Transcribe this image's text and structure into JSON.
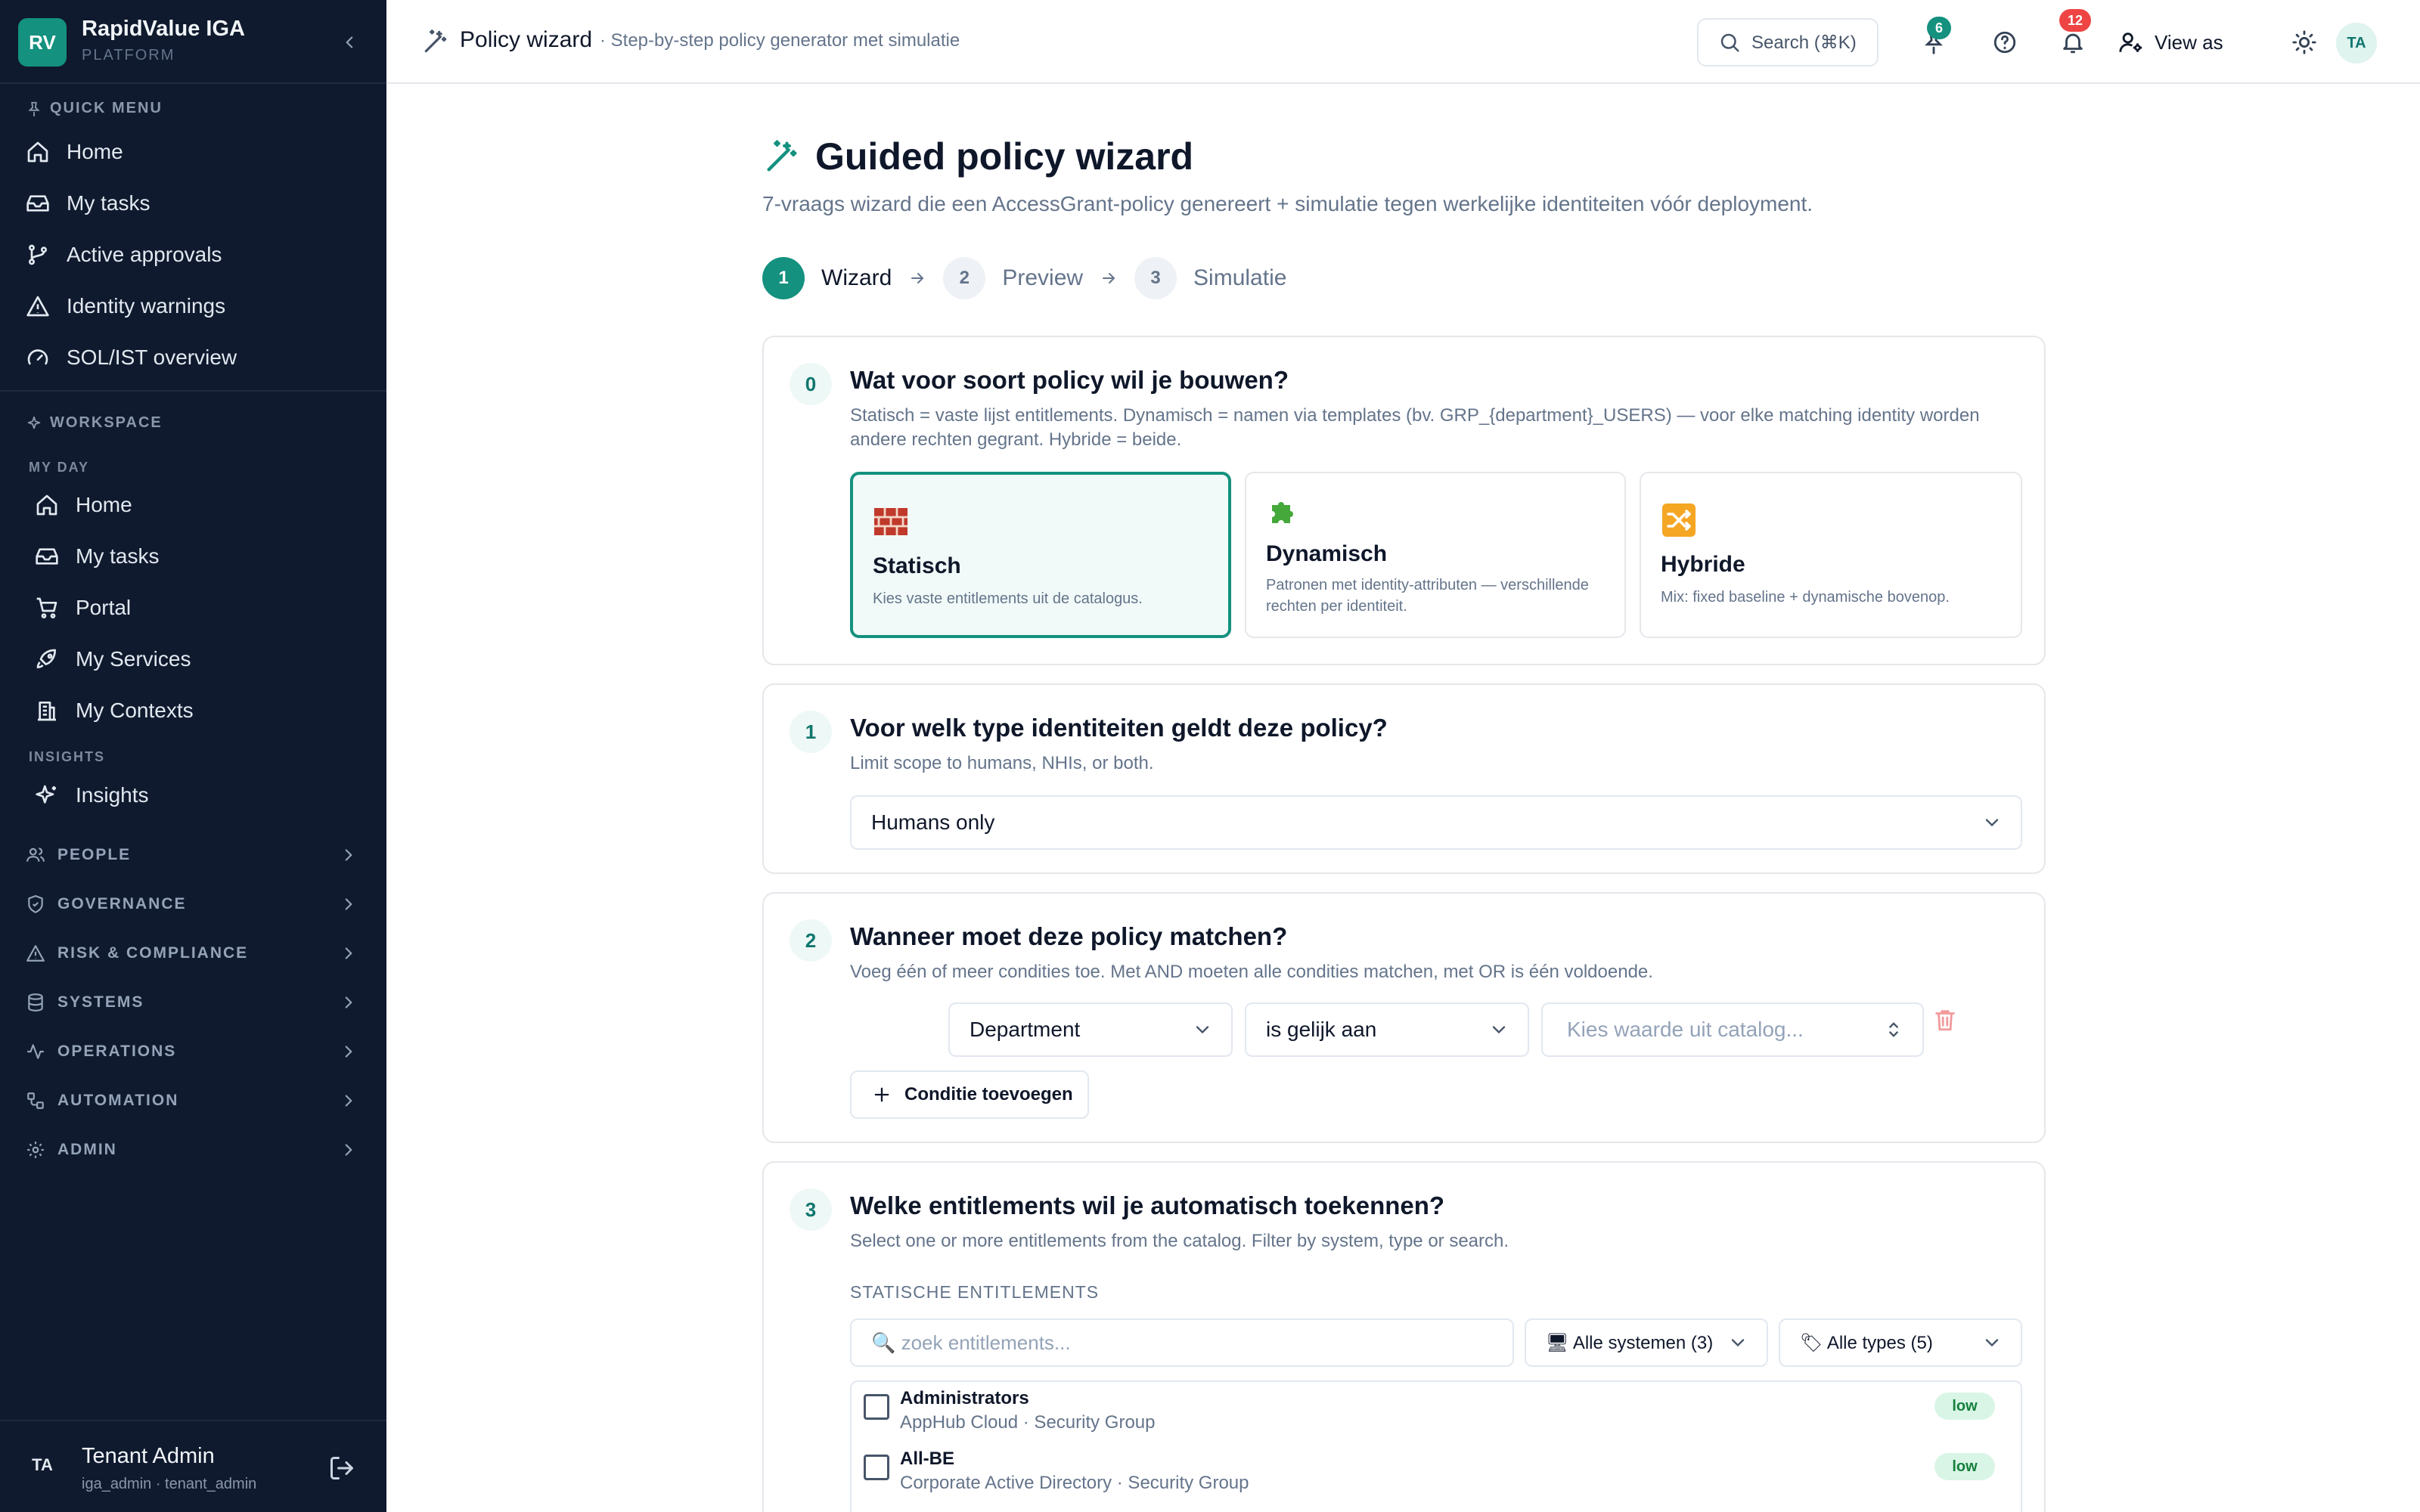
{
  "sidebar": {
    "brand": {
      "logo": "RV",
      "title": "RapidValue IGA",
      "subtitle": "PLATFORM"
    },
    "quick_menu": {
      "label": "QUICK MENU",
      "items": [
        "Home",
        "My tasks",
        "Active approvals",
        "Identity warnings",
        "SOL/IST overview"
      ]
    },
    "workspace": {
      "label": "WORKSPACE",
      "groups": [
        {
          "label": "MY DAY",
          "items": [
            "Home",
            "My tasks",
            "Portal",
            "My Services",
            "My Contexts"
          ]
        },
        {
          "label": "INSIGHTS",
          "items": [
            "Insights"
          ]
        }
      ]
    },
    "categories": [
      "PEOPLE",
      "GOVERNANCE",
      "RISK & COMPLIANCE",
      "SYSTEMS",
      "OPERATIONS",
      "AUTOMATION",
      "ADMIN"
    ],
    "user": {
      "initials": "TA",
      "name": "Tenant Admin",
      "sub": "iga_admin · tenant_admin"
    }
  },
  "topbar": {
    "title": "Policy wizard",
    "subtitle": "· Step-by-step policy generator met simulatie",
    "search_label": "Search (⌘K)",
    "pins_badge": "6",
    "notifications_badge": "12",
    "view_as": "View as",
    "avatar": "TA",
    "colors": {
      "pins_badge": "#14917f",
      "notifications_badge": "#ef4444"
    }
  },
  "main": {
    "title": "Guided policy wizard",
    "subtitle": "7-vraags wizard die een AccessGrant-policy genereert + simulatie tegen werkelijke identiteiten vóór deployment.",
    "steps": [
      {
        "num": "1",
        "label": "Wizard"
      },
      {
        "num": "2",
        "label": "Preview"
      },
      {
        "num": "3",
        "label": "Simulatie"
      }
    ],
    "q0": {
      "num": "0",
      "title": "Wat voor soort policy wil je bouwen?",
      "desc_line1": "Statisch = vaste lijst entitlements. Dynamisch = namen via templates (bv. GRP_{department}_USERS) — voor elke matching identity worden",
      "desc_line2": "andere rechten gegrant. Hybride = beide.",
      "options": [
        {
          "icon": "brick-icon",
          "title": "Statisch",
          "desc": "Kies vaste entitlements uit de catalogus."
        },
        {
          "icon": "puzzle-icon",
          "title": "Dynamisch",
          "desc_line1": "Patronen met identity-attributen — verschillende",
          "desc_line2": "rechten per identiteit."
        },
        {
          "icon": "shuffle-icon",
          "title": "Hybride",
          "desc": "Mix: fixed baseline + dynamische bovenop."
        }
      ]
    },
    "q1": {
      "num": "1",
      "title": "Voor welk type identiteiten geldt deze policy?",
      "desc": "Limit scope to humans, NHIs, or both.",
      "selected": "Humans only"
    },
    "q2": {
      "num": "2",
      "title": "Wanneer moet deze policy matchen?",
      "desc": "Voeg één of meer condities toe. Met AND moeten alle condities matchen, met OR is één voldoende.",
      "attribute": "Department",
      "operator": "is gelijk aan",
      "value_placeholder": "Kies waarde uit catalog...",
      "add_label": "Conditie toevoegen"
    },
    "q3": {
      "num": "3",
      "title": "Welke entitlements wil je automatisch toekennen?",
      "desc": "Select one or more entitlements from the catalog. Filter by system, type or search.",
      "section_label": "STATISCHE ENTITLEMENTS",
      "search_placeholder": "🔍 zoek entitlements...",
      "systems_filter": "🖥 Alle systemen (3)",
      "types_filter": "🏷 Alle types (5)",
      "entitlements": [
        {
          "name": "Administrators",
          "meta": "AppHub Cloud · Security Group",
          "risk": "low"
        },
        {
          "name": "All-BE",
          "meta": "Corporate Active Directory · Security Group",
          "risk": "low"
        }
      ]
    }
  },
  "colors": {
    "accent": "#14917f",
    "sidebar_bg": "#0f1a2e"
  }
}
